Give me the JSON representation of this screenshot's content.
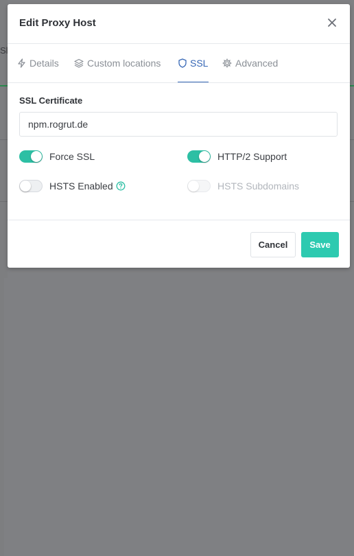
{
  "modal": {
    "title": "Edit Proxy Host",
    "close_label": "×"
  },
  "tabs": [
    {
      "label": "Details",
      "icon": "bolt-icon"
    },
    {
      "label": "Custom locations",
      "icon": "layers-icon"
    },
    {
      "label": "SSL",
      "icon": "shield-icon",
      "active": true
    },
    {
      "label": "Advanced",
      "icon": "gear-icon"
    }
  ],
  "ssl": {
    "certificate_label": "SSL Certificate",
    "certificate_value": "npm.rogrut.de",
    "toggles": [
      {
        "label": "Force SSL",
        "on": true
      },
      {
        "label": "HTTP/2 Support",
        "on": true
      },
      {
        "label": "HSTS Enabled",
        "on": false,
        "help": true
      },
      {
        "label": "HSTS Subdomains",
        "on": false,
        "disabled": true
      }
    ]
  },
  "footer": {
    "cancel_label": "Cancel",
    "save_label": "Save"
  },
  "colors": {
    "accent": "#2dcab0",
    "active_tab": "#3566b5"
  },
  "background": {
    "left_fragment": "Sl"
  }
}
